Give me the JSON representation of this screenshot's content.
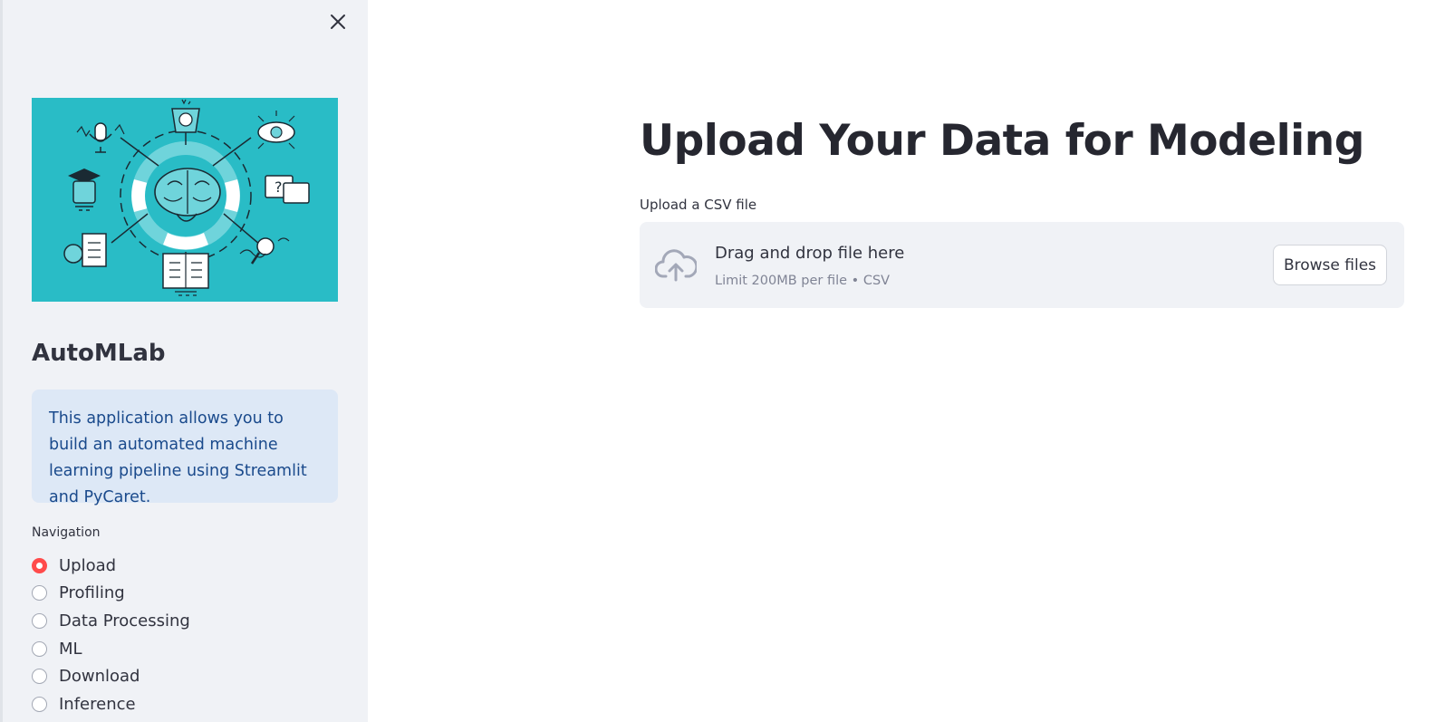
{
  "sidebar": {
    "app_title": "AutoMLab",
    "info_text": "This application allows you to build an automated machine learning pipeline using Streamlit and PyCaret.",
    "nav_label": "Navigation",
    "nav_items": [
      {
        "label": "Upload",
        "selected": true
      },
      {
        "label": "Profiling",
        "selected": false
      },
      {
        "label": "Data Processing",
        "selected": false
      },
      {
        "label": "ML",
        "selected": false
      },
      {
        "label": "Download",
        "selected": false
      },
      {
        "label": "Inference",
        "selected": false
      }
    ],
    "hero_icon": "ai-brain-illustration",
    "close_icon": "close-icon"
  },
  "main": {
    "title": "Upload Your Data for Modeling",
    "uploader": {
      "label": "Upload a CSV file",
      "drop_text": "Drag and drop file here",
      "limit_text": "Limit 200MB per file • CSV",
      "browse_label": "Browse files",
      "icon": "cloud-upload-icon"
    }
  },
  "colors": {
    "sidebar_bg": "#f0f2f6",
    "accent": "#ff4b4b",
    "hero_bg": "#29bcc6",
    "info_bg": "#dde8f6",
    "info_text": "#1a4a8c"
  }
}
